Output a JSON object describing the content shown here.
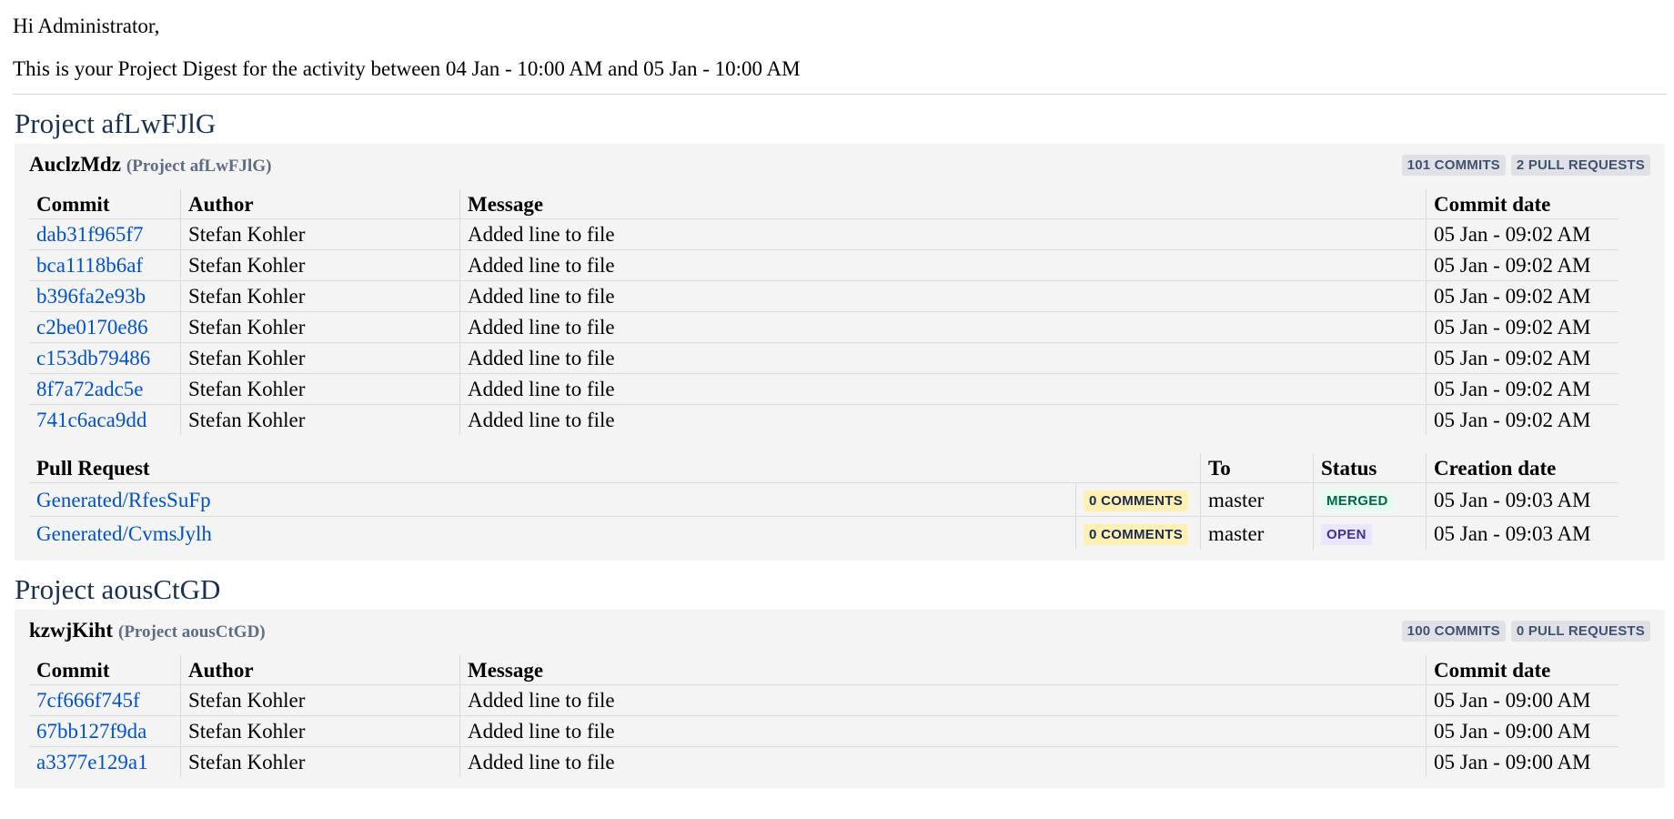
{
  "greeting": "Hi Administrator,",
  "intro": "This is your Project Digest for the activity between 04 Jan - 10:00 AM and 05 Jan - 10:00 AM",
  "commit_headers": {
    "commit": "Commit",
    "author": "Author",
    "message": "Message",
    "date": "Commit date"
  },
  "pr_headers": {
    "pr": "Pull Request",
    "to": "To",
    "status": "Status",
    "date": "Creation date"
  },
  "projects": [
    {
      "title": "Project afLwFJlG",
      "repo_name": "AuclzMdz",
      "repo_project": "(Project afLwFJlG)",
      "commits_badge": "101 COMMITS",
      "prs_badge": "2 PULL REQUESTS",
      "commits": [
        {
          "hash": "dab31f965f7",
          "author": "Stefan Kohler",
          "message": "Added line to file",
          "date": "05 Jan - 09:02 AM"
        },
        {
          "hash": "bca1118b6af",
          "author": "Stefan Kohler",
          "message": "Added line to file",
          "date": "05 Jan - 09:02 AM"
        },
        {
          "hash": "b396fa2e93b",
          "author": "Stefan Kohler",
          "message": "Added line to file",
          "date": "05 Jan - 09:02 AM"
        },
        {
          "hash": "c2be0170e86",
          "author": "Stefan Kohler",
          "message": "Added line to file",
          "date": "05 Jan - 09:02 AM"
        },
        {
          "hash": "c153db79486",
          "author": "Stefan Kohler",
          "message": "Added line to file",
          "date": "05 Jan - 09:02 AM"
        },
        {
          "hash": "8f7a72adc5e",
          "author": "Stefan Kohler",
          "message": "Added line to file",
          "date": "05 Jan - 09:02 AM"
        },
        {
          "hash": "741c6aca9dd",
          "author": "Stefan Kohler",
          "message": "Added line to file",
          "date": "05 Jan - 09:02 AM"
        }
      ],
      "pull_requests": [
        {
          "name": "Generated/RfesSuFp",
          "comments": "0 COMMENTS",
          "to": "master",
          "status": "MERGED",
          "date": "05 Jan - 09:03 AM"
        },
        {
          "name": "Generated/CvmsJylh",
          "comments": "0 COMMENTS",
          "to": "master",
          "status": "OPEN",
          "date": "05 Jan - 09:03 AM"
        }
      ]
    },
    {
      "title": "Project aousCtGD",
      "repo_name": "kzwjKiht",
      "repo_project": "(Project aousCtGD)",
      "commits_badge": "100 COMMITS",
      "prs_badge": "0 PULL REQUESTS",
      "commits": [
        {
          "hash": "7cf666f745f",
          "author": "Stefan Kohler",
          "message": "Added line to file",
          "date": "05 Jan - 09:00 AM"
        },
        {
          "hash": "67bb127f9da",
          "author": "Stefan Kohler",
          "message": "Added line to file",
          "date": "05 Jan - 09:00 AM"
        },
        {
          "hash": "a3377e129a1",
          "author": "Stefan Kohler",
          "message": "Added line to file",
          "date": "05 Jan - 09:00 AM"
        }
      ]
    }
  ]
}
